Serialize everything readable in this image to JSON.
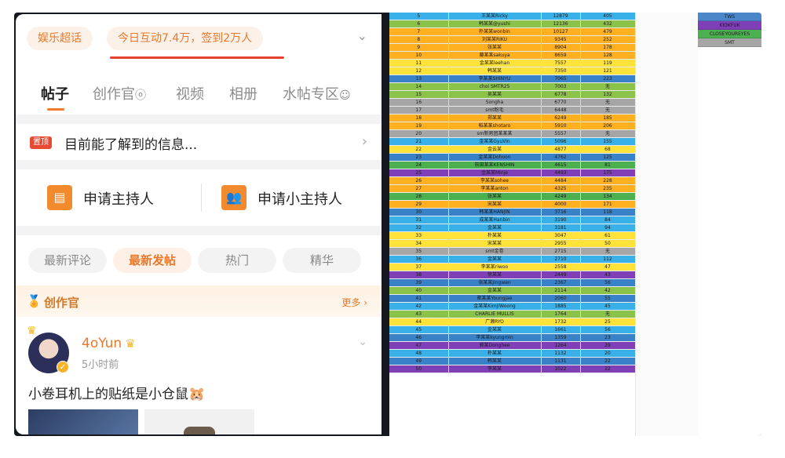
{
  "header": {
    "chip_label": "娱乐超话",
    "stats_label": "今日互动7.4万，签到2万人",
    "expand_icon": "chevron-down-icon"
  },
  "tabs": [
    "帖子",
    "创作官",
    "视频",
    "相册",
    "水帖专区"
  ],
  "notice": {
    "badge": "置顶",
    "text": "目前能了解到的信息..."
  },
  "hosts": {
    "apply_host": "申请主持人",
    "apply_small_host": "申请小主持人"
  },
  "filters": [
    "最新评论",
    "最新发帖",
    "热门",
    "精华"
  ],
  "creator_section": {
    "title": "创作官",
    "more": "更多"
  },
  "post": {
    "username": "4oYun",
    "time": "5小时前",
    "text": "小卷耳机上的贴纸是小仓鼠🐹"
  },
  "legend": [
    {
      "label": "TWS",
      "color": "#4a86c8"
    },
    {
      "label": "KIOKFUK",
      "color": "#7f3fb6"
    },
    {
      "label": "CLOSEYOUREYES",
      "color": "#4caf50"
    },
    {
      "label": "SMT",
      "color": "#a6a6a6"
    }
  ],
  "rank_rows": [
    [
      "5",
      "王某某Ricky",
      "12879",
      "405",
      "#3ab0e8"
    ],
    [
      "6",
      "韩某某@yushi",
      "12136",
      "432",
      "#8bc34a"
    ],
    [
      "7",
      "朴某某wonbin",
      "10127",
      "479",
      "#ffb020"
    ],
    [
      "8",
      "刘某某RIKU",
      "9345",
      "252",
      "#ffb020"
    ],
    [
      "9",
      "张某某",
      "8904",
      "178",
      "#ffb020"
    ],
    [
      "10",
      "藤某某sakuya",
      "8659",
      "128",
      "#ffb020"
    ],
    [
      "11",
      "金某某leehan",
      "7557",
      "119",
      "#ffe33a"
    ],
    [
      "12",
      "韩某某",
      "7350",
      "121",
      "#ffe33a"
    ],
    [
      "13",
      "李某某SHINYU",
      "7065",
      "223",
      "#3a82c8"
    ],
    [
      "14",
      "choi SMTR25",
      "7003",
      "无",
      "#8bc34a"
    ],
    [
      "15",
      "吴某某",
      "6778",
      "132",
      "#8bc34a"
    ],
    [
      "16",
      "Songha",
      "6770",
      "无",
      "#a6a6a6"
    ],
    [
      "17",
      "smt粉毛",
      "6448",
      "无",
      "#a6a6a6"
    ],
    [
      "18",
      "郑某某",
      "6249",
      "185",
      "#ffb020"
    ],
    [
      "19",
      "稻某某shotaro",
      "5910",
      "206",
      "#ffb020"
    ],
    [
      "20",
      "sm新男团某某某",
      "5557",
      "无",
      "#a6a6a6"
    ],
    [
      "21",
      "金某某GyuVin",
      "5096",
      "155",
      "#3ab0e8"
    ],
    [
      "22",
      "金云某",
      "4877",
      "68",
      "#ffe33a"
    ],
    [
      "23",
      "金某某Dohoon",
      "4762",
      "125",
      "#3a82c8"
    ],
    [
      "24",
      "前田某某KENSHIN",
      "4615",
      "81",
      "#4caf50"
    ],
    [
      "25",
      "金某某Minje",
      "4493",
      "175",
      "#7f3fb6"
    ],
    [
      "26",
      "李某某sohee",
      "4484",
      "228",
      "#ffb020"
    ],
    [
      "27",
      "李某某anton",
      "4325",
      "235",
      "#ffb020"
    ],
    [
      "28",
      "张某某",
      "4249",
      "134",
      "#4caf50"
    ],
    [
      "29",
      "宋某某",
      "4000",
      "171",
      "#ffb020"
    ],
    [
      "30",
      "韩某某HANJIN",
      "3716",
      "118",
      "#3a82c8"
    ],
    [
      "31",
      "成某某Hanbin",
      "3190",
      "84",
      "#3ab0e8"
    ],
    [
      "32",
      "金某某",
      "3181",
      "94",
      "#3ab0e8"
    ],
    [
      "33",
      "朴某某",
      "3047",
      "61",
      "#ffe33a"
    ],
    [
      "34",
      "宋某某",
      "2955",
      "50",
      "#ffe33a"
    ],
    [
      "35",
      "smt金卷",
      "2715",
      "无",
      "#a6a6a6"
    ],
    [
      "36",
      "金某某",
      "2710",
      "112",
      "#3ab0e8"
    ],
    [
      "37",
      "李某某riwoo",
      "2558",
      "47",
      "#ffe33a"
    ],
    [
      "38",
      "徐某某",
      "2449",
      "43",
      "#7f3fb6"
    ],
    [
      "39",
      "张某某Jingwen",
      "2367",
      "56",
      "#3a82c8"
    ],
    [
      "40",
      "金某某",
      "2114",
      "42",
      "#8bc34a"
    ],
    [
      "41",
      "崔某某Youngjae",
      "2060",
      "55",
      "#3a82c8"
    ],
    [
      "42",
      "金某某KimJiWoong",
      "1885",
      "45",
      "#3ab0e8"
    ],
    [
      "43",
      "CHARLIE MULLIS",
      "1764",
      "无",
      "#8bc34a"
    ],
    [
      "44",
      "广濑RYO",
      "1732",
      "25",
      "#ffe33a"
    ],
    [
      "45",
      "金某某",
      "1661",
      "56",
      "#3ab0e8"
    ],
    [
      "46",
      "李某某kyungmin",
      "1359",
      "23",
      "#3a82c8"
    ],
    [
      "47",
      "郭某Donghee",
      "1264",
      "29",
      "#7f3fb6"
    ],
    [
      "48",
      "朴某某",
      "1132",
      "20",
      "#3ab0e8"
    ],
    [
      "49",
      "韩某某",
      "1131",
      "22",
      "#3a82c8"
    ],
    [
      "50",
      "李某某",
      "1022",
      "22",
      "#7f3fb6"
    ]
  ]
}
